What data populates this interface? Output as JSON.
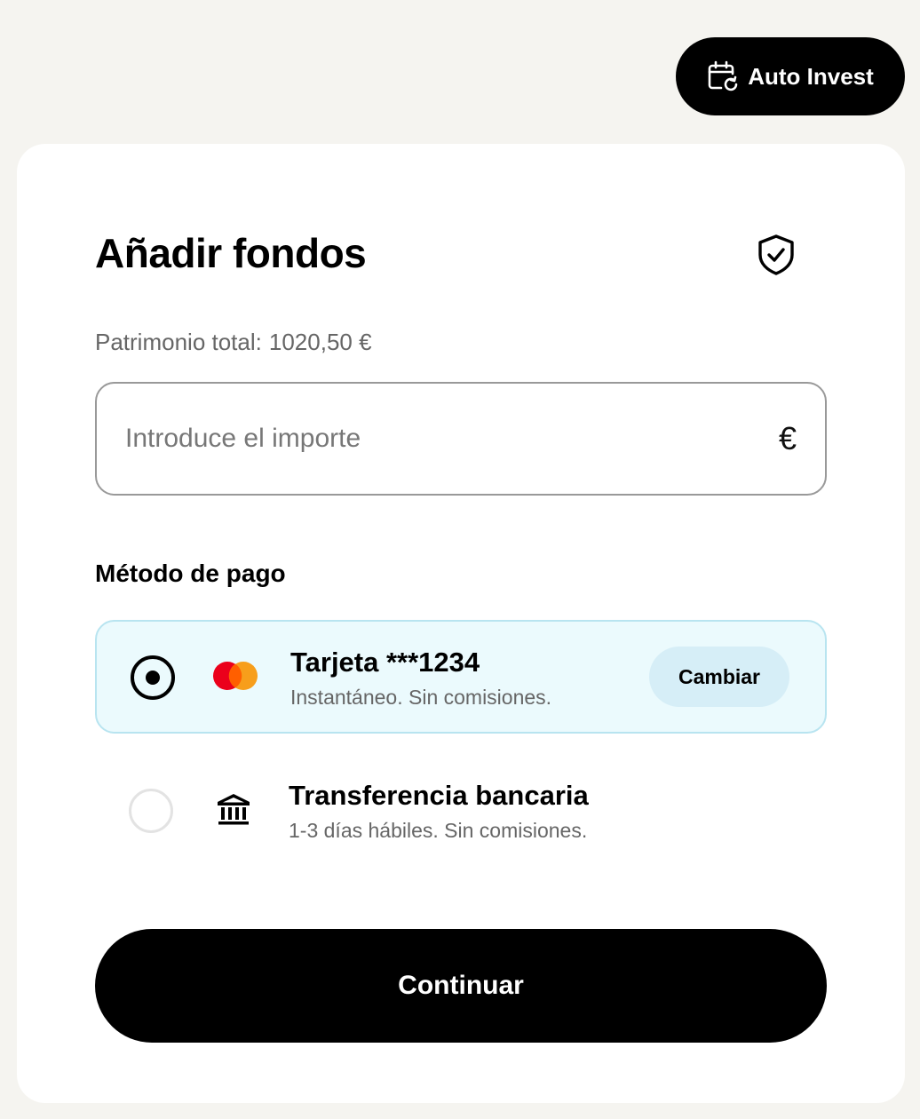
{
  "header": {
    "auto_invest_label": "Auto Invest",
    "auto_invest_icon": "calendar-refresh-icon"
  },
  "card": {
    "title": "Añadir fondos",
    "security_icon": "shield-check-icon",
    "patrimonio_label": "Patrimonio total:",
    "patrimonio_value": "1020,50 €",
    "amount_input": {
      "placeholder": "Introduce el importe",
      "value": "",
      "currency_symbol": "€"
    },
    "payment_method_heading": "Método de pago",
    "options": [
      {
        "title": "Tarjeta ***1234",
        "subtitle": "Instantáneo. Sin comisiones.",
        "selected": true,
        "icon": "mastercard-icon",
        "action_label": "Cambiar"
      },
      {
        "title": "Transferencia bancaria",
        "subtitle": "1-3 días hábiles. Sin comisiones.",
        "selected": false,
        "icon": "bank-icon"
      }
    ],
    "continue_label": "Continuar"
  },
  "colors": {
    "page_bg": "#f5f4f0",
    "card_bg": "#ffffff",
    "selected_bg": "#ebfafd",
    "selected_border": "#b8e4f0",
    "change_button_bg": "#d6eef7",
    "primary": "#000000",
    "mastercard_red": "#eb001b",
    "mastercard_orange": "#f79e1b"
  }
}
